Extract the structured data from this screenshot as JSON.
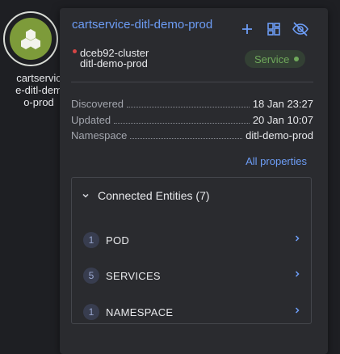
{
  "node": {
    "label": "cartservic\ne-ditl-dem\no-prod",
    "icon": "hexagon-cluster-icon",
    "color": "#7d9b3a"
  },
  "card": {
    "title": "cartservice-ditl-demo-prod",
    "actions": [
      "add-icon",
      "grid-view-icon",
      "hide-icon"
    ],
    "cluster": "dceb92-cluster",
    "namespace_line": "ditl-demo-prod",
    "badge": "Service",
    "properties": [
      {
        "key": "Discovered",
        "value": "18 Jan 23:27"
      },
      {
        "key": "Updated",
        "value": "20 Jan 10:07"
      },
      {
        "key": "Namespace",
        "value": "ditl-demo-prod"
      }
    ],
    "all_properties_link": "All properties",
    "connected": {
      "header": "Connected Entities (7)",
      "rows": [
        {
          "count": "1",
          "name": "POD"
        },
        {
          "count": "5",
          "name": "SERVICES"
        },
        {
          "count": "1",
          "name": "NAMESPACE"
        }
      ]
    }
  },
  "colors": {
    "accent_blue": "#6d9df6",
    "status_green": "#6fa85b",
    "status_red": "#d64545"
  }
}
